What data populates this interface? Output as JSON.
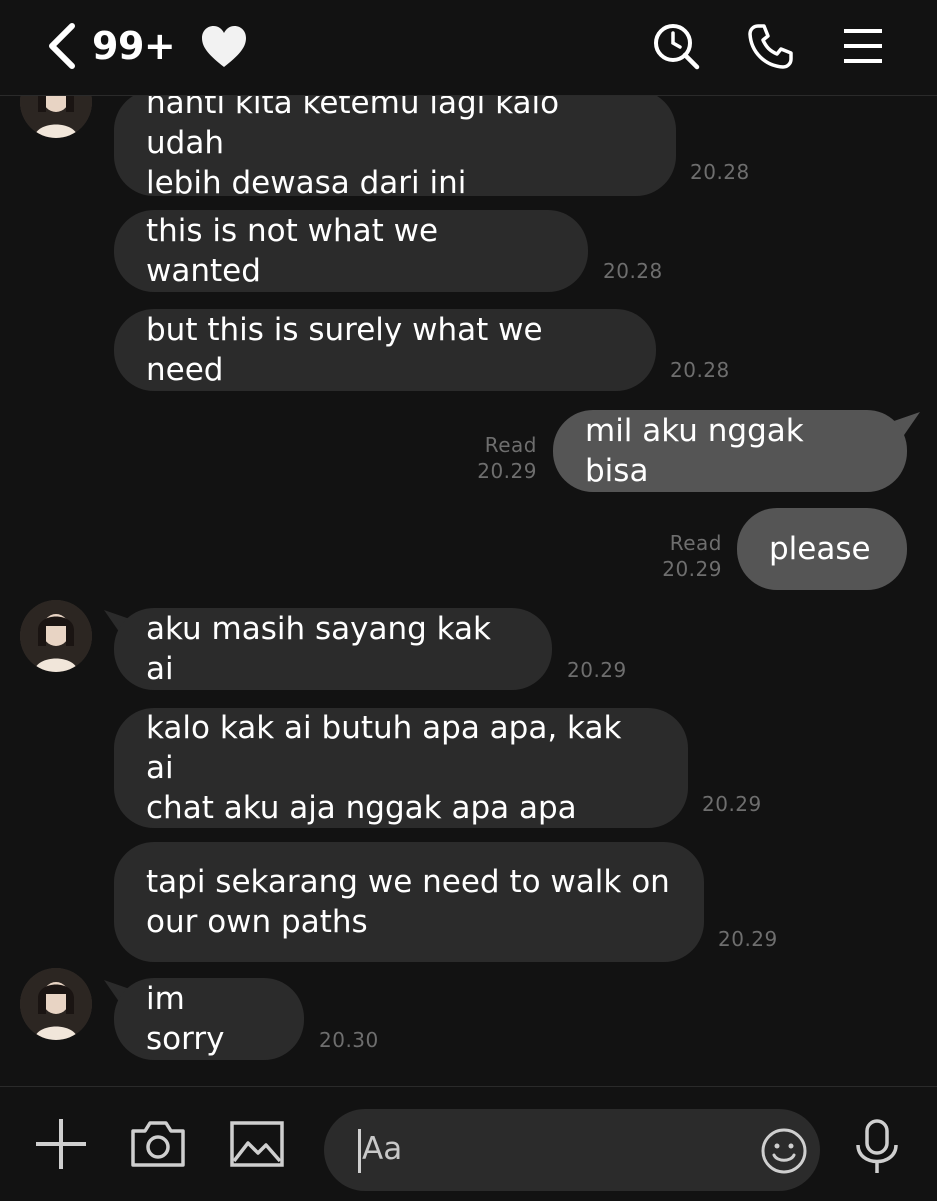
{
  "header": {
    "unread_count": "99+",
    "icons": [
      "back-chevron-icon",
      "heart-icon",
      "search-clock-icon",
      "phone-icon",
      "menu-icon"
    ]
  },
  "messages": {
    "m1": {
      "text": "nanti kita ketemu lagi kalo udah\nlebih dewasa dari ini",
      "time": "20.28"
    },
    "m2": {
      "text": "this is not what we wanted",
      "time": "20.28"
    },
    "m3": {
      "text": "but this is surely what we need",
      "time": "20.28"
    },
    "m4": {
      "text": "mil aku nggak bisa",
      "read": "Read",
      "time": "20.29"
    },
    "m5": {
      "text": "please",
      "read": "Read",
      "time": "20.29"
    },
    "m6": {
      "text": "aku masih sayang kak ai",
      "time": "20.29"
    },
    "m7": {
      "text": "kalo kak ai butuh apa apa, kak ai\nchat aku aja nggak apa apa",
      "time": "20.29"
    },
    "m8": {
      "text": "tapi sekarang we need to walk on\nour own paths",
      "time": "20.29"
    },
    "m9": {
      "text": "im sorry",
      "time": "20.30"
    }
  },
  "composer": {
    "placeholder": "Aa",
    "icons": [
      "plus-icon",
      "camera-icon",
      "image-icon",
      "emoji-icon",
      "microphone-icon"
    ]
  },
  "colors": {
    "background": "#121212",
    "incoming_bubble": "#2b2b2b",
    "outgoing_bubble": "#555555",
    "timestamp": "#6e6e6e"
  }
}
